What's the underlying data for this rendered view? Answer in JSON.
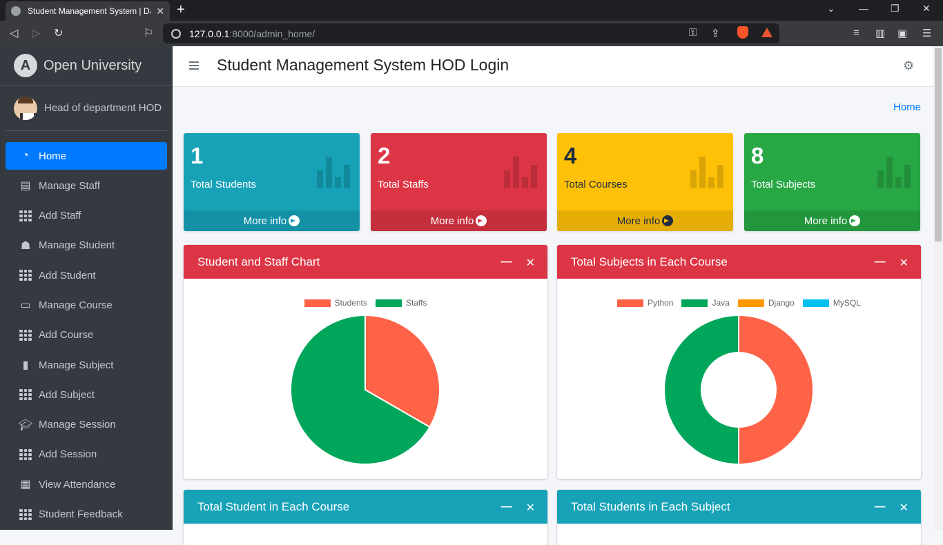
{
  "browser": {
    "tab_title": "Student Management System | Dashboard",
    "url_host": "127.0.0.1",
    "url_path": ":8000/admin_home/"
  },
  "sidebar": {
    "brand": "Open University",
    "user": "Head of department HOD",
    "items": [
      {
        "label": "Home",
        "icon": "dashboard-icon"
      },
      {
        "label": "Manage Staff",
        "icon": "user-card-icon"
      },
      {
        "label": "Add Staff",
        "icon": "grid-icon"
      },
      {
        "label": "Manage Student",
        "icon": "user-graduate-icon"
      },
      {
        "label": "Add Student",
        "icon": "grid-icon"
      },
      {
        "label": "Manage Course",
        "icon": "laptop-icon"
      },
      {
        "label": "Add Course",
        "icon": "grid-icon"
      },
      {
        "label": "Manage Subject",
        "icon": "book-icon"
      },
      {
        "label": "Add Subject",
        "icon": "grid-icon"
      },
      {
        "label": "Manage Session",
        "icon": "graduation-cap-icon"
      },
      {
        "label": "Add Session",
        "icon": "grid-icon"
      },
      {
        "label": "View Attendance",
        "icon": "calendar-icon"
      },
      {
        "label": "Student Feedback",
        "icon": "grid-icon"
      }
    ]
  },
  "header": {
    "title": "Student Management System HOD Login"
  },
  "breadcrumb": "Home",
  "stats": [
    {
      "value": "1",
      "label": "Total Students",
      "more": "More info",
      "color": "#17a2b8",
      "text": "#ffffff"
    },
    {
      "value": "2",
      "label": "Total Staffs",
      "more": "More info",
      "color": "#dc3545",
      "text": "#ffffff"
    },
    {
      "value": "4",
      "label": "Total Courses",
      "more": "More info",
      "color": "#ffc107",
      "text": "#1f2d3d"
    },
    {
      "value": "8",
      "label": "Total Subjects",
      "more": "More info",
      "color": "#28a745",
      "text": "#ffffff"
    }
  ],
  "cards": {
    "staff_chart": {
      "title": "Student and Staff Chart"
    },
    "subjects_chart": {
      "title": "Total Subjects in Each Course"
    },
    "students_course": {
      "title": "Total Student in Each Course"
    },
    "students_subject": {
      "title": "Total Students in Each Subject"
    }
  },
  "chart_data": [
    {
      "type": "pie",
      "categories": [
        "Students",
        "Staffs"
      ],
      "values": [
        1,
        2
      ],
      "colors": [
        "#ff6347",
        "#00a65a"
      ]
    },
    {
      "type": "pie",
      "style": "doughnut",
      "categories": [
        "Python",
        "Java",
        "Django",
        "MySQL"
      ],
      "values": [
        1,
        1,
        0,
        0
      ],
      "colors": [
        "#ff6347",
        "#00a65a",
        "#ff9800",
        "#00c0ef"
      ]
    }
  ]
}
